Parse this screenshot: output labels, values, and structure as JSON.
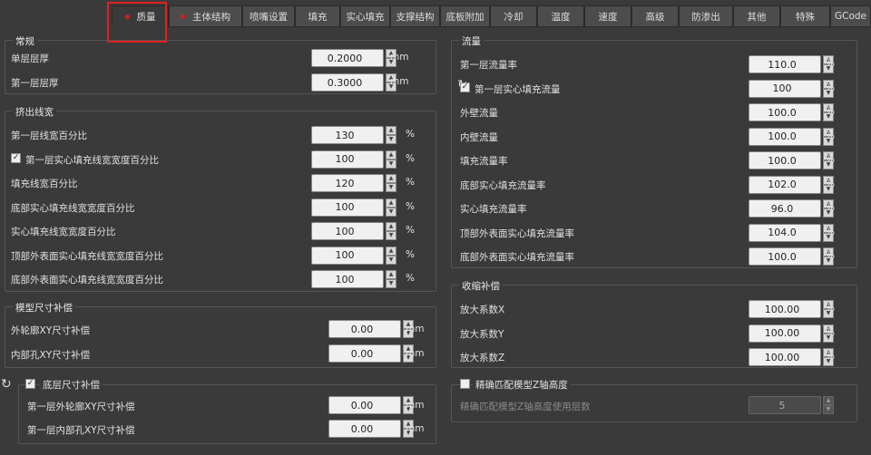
{
  "tabs": [
    {
      "label": "质量",
      "dot": true
    },
    {
      "label": "主体结构",
      "dot": true
    },
    {
      "label": "喷嘴设置"
    },
    {
      "label": "填充"
    },
    {
      "label": "实心填充"
    },
    {
      "label": "支撑结构"
    },
    {
      "label": "底板附加"
    },
    {
      "label": "冷却"
    },
    {
      "label": "温度"
    },
    {
      "label": "速度"
    },
    {
      "label": "高级"
    },
    {
      "label": "防渗出"
    },
    {
      "label": "其他"
    },
    {
      "label": "特殊"
    },
    {
      "label": "GCode"
    }
  ],
  "general": {
    "title": "常规",
    "layer_height": {
      "label": "单层层厚",
      "value": "0.2000",
      "unit": "mm"
    },
    "first_layer_height": {
      "label": "第一层层厚",
      "value": "0.3000",
      "unit": "mm"
    }
  },
  "extrusion_width": {
    "title": "挤出线宽",
    "rows": [
      {
        "label": "第一层线宽百分比",
        "value": "130",
        "unit": "%"
      },
      {
        "label": "第一层实心填充线宽宽度百分比",
        "value": "100",
        "unit": "%",
        "checked": true
      },
      {
        "label": "填充线宽百分比",
        "value": "120",
        "unit": "%"
      },
      {
        "label": "底部实心填充线宽宽度百分比",
        "value": "100",
        "unit": "%"
      },
      {
        "label": "实心填充线宽宽度百分比",
        "value": "100",
        "unit": "%"
      },
      {
        "label": "顶部外表面实心填充线宽宽度百分比",
        "value": "100",
        "unit": "%"
      },
      {
        "label": "底部外表面实心填充线宽宽度百分比",
        "value": "100",
        "unit": "%"
      }
    ]
  },
  "size_comp": {
    "title": "模型尺寸补偿",
    "outer": {
      "label": "外轮廓XY尺寸补偿",
      "value": "0.00",
      "unit": "mm"
    },
    "inner": {
      "label": "内部孔XY尺寸补偿",
      "value": "0.00",
      "unit": "mm"
    }
  },
  "bottom_comp": {
    "title": "底层尺寸补偿",
    "checked": true,
    "outer": {
      "label": "第一层外轮廓XY尺寸补偿",
      "value": "0.00",
      "unit": "mm"
    },
    "inner": {
      "label": "第一层内部孔XY尺寸补偿",
      "value": "0.00",
      "unit": "mm"
    }
  },
  "flow": {
    "title": "流量",
    "rows": [
      {
        "label": "第一层流量率",
        "value": "110.0",
        "unit": "%"
      },
      {
        "label": "第一层实心填充流量",
        "value": "100",
        "unit": "%",
        "checked": true
      },
      {
        "label": "外壁流量",
        "value": "100.0",
        "unit": "%"
      },
      {
        "label": "内壁流量",
        "value": "100.0",
        "unit": "%"
      },
      {
        "label": "填充流量率",
        "value": "100.0",
        "unit": "%"
      },
      {
        "label": "底部实心填充流量率",
        "value": "102.0",
        "unit": "%"
      },
      {
        "label": "实心填充流量率",
        "value": "96.0",
        "unit": "%"
      },
      {
        "label": "顶部外表面实心填充流量率",
        "value": "104.0",
        "unit": "%"
      },
      {
        "label": "底部外表面实心填充流量率",
        "value": "100.0",
        "unit": "%"
      }
    ]
  },
  "shrink": {
    "title": "收缩补偿",
    "rows": [
      {
        "label": "放大系数X",
        "value": "100.00",
        "unit": "%"
      },
      {
        "label": "放大系数Y",
        "value": "100.00",
        "unit": "%"
      },
      {
        "label": "放大系数Z",
        "value": "100.00",
        "unit": "%"
      }
    ]
  },
  "zmatch": {
    "title": "精确匹配模型Z轴高度",
    "checked": false,
    "row": {
      "label": "精确匹配模型Z轴高度使用层数",
      "value": "5"
    }
  },
  "icons": {
    "reset": "reset-icon",
    "arrow_up": "arrow-up-icon",
    "arrow_down": "arrow-down-icon",
    "check": "checkmark-icon"
  },
  "colors": {
    "active_dot": "#d22020",
    "highlight_box": "#e02020",
    "background": "#3a3a3a"
  }
}
